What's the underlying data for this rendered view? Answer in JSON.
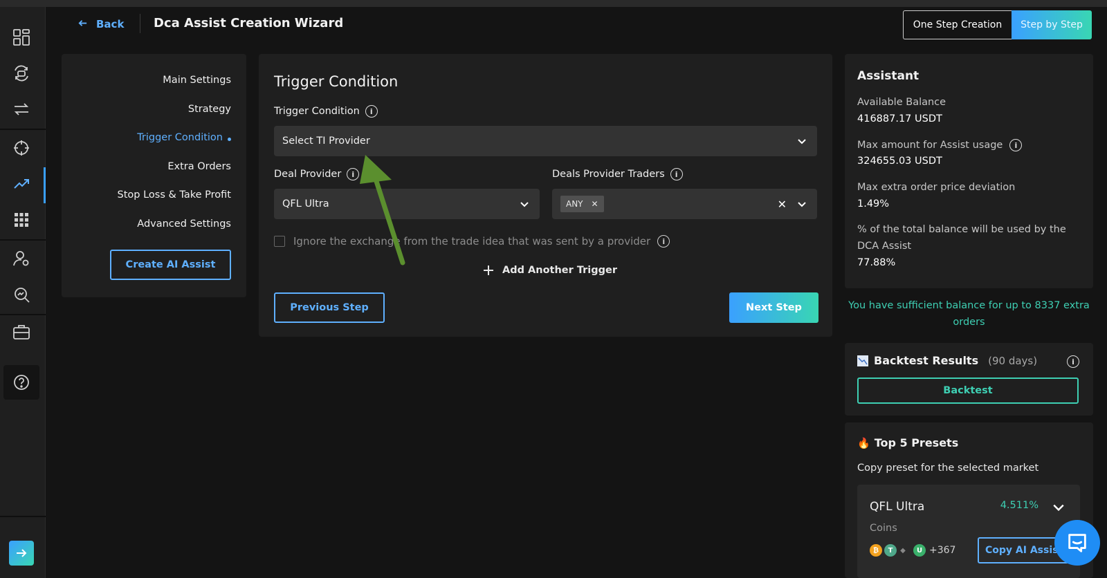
{
  "header": {
    "back_label": "Back",
    "title": "Dca Assist Creation Wizard",
    "mode_one": "One Step Creation",
    "mode_step": "Step by Step"
  },
  "steps": {
    "items": [
      "Main Settings",
      "Strategy",
      "Trigger Condition",
      "Extra Orders",
      "Stop Loss & Take Profit",
      "Advanced Settings"
    ],
    "active_index": 2,
    "create_button": "Create AI Assist"
  },
  "main": {
    "title": "Trigger Condition",
    "trigger_label": "Trigger Condition",
    "trigger_select": "Select TI Provider",
    "deal_provider_label": "Deal Provider",
    "deal_provider_value": "QFL Ultra",
    "traders_label": "Deals Provider Traders",
    "traders_tag": "ANY",
    "ignore_label": "Ignore the exchange from the trade idea that was sent by a provider",
    "add_trigger": "Add Another Trigger",
    "prev_button": "Previous Step",
    "next_button": "Next Step"
  },
  "assistant": {
    "title": "Assistant",
    "available_label": "Available Balance",
    "available_value": "416887.17 USDT",
    "max_label": "Max amount for Assist usage",
    "max_value": "324655.03 USDT",
    "deviation_label": "Max extra order price deviation",
    "deviation_value": "1.49%",
    "total_label_1": "% of the total balance will be used by the",
    "total_label_2": "DCA Assist",
    "total_value": "77.88%",
    "sufficient_1": "You have sufficient balance for up to 8337 extra",
    "sufficient_2": "orders"
  },
  "backtest": {
    "title": "Backtest Results",
    "period": "(90 days)",
    "button": "Backtest"
  },
  "presets": {
    "title": "Top 5 Presets",
    "subtitle": "Copy preset for the selected market",
    "card_name": "QFL Ultra",
    "card_pct": "4.511%",
    "coins_label": "Coins",
    "coins_more": "+367",
    "copy_button": "Copy AI Assist"
  },
  "colors": {
    "accent_blue": "#3aa0ff",
    "accent_teal": "#39d6b3",
    "success_text": "#3ecfb3",
    "annotation_arrow": "#5b8f2e"
  },
  "icons": [
    "dashboard-icon",
    "bots-icon",
    "exchange-icon",
    "target-icon",
    "chart-icon",
    "apps-icon",
    "user-icon",
    "search-chart-icon",
    "briefcase-icon",
    "help-icon",
    "arrow-right-icon",
    "chat-icon"
  ]
}
